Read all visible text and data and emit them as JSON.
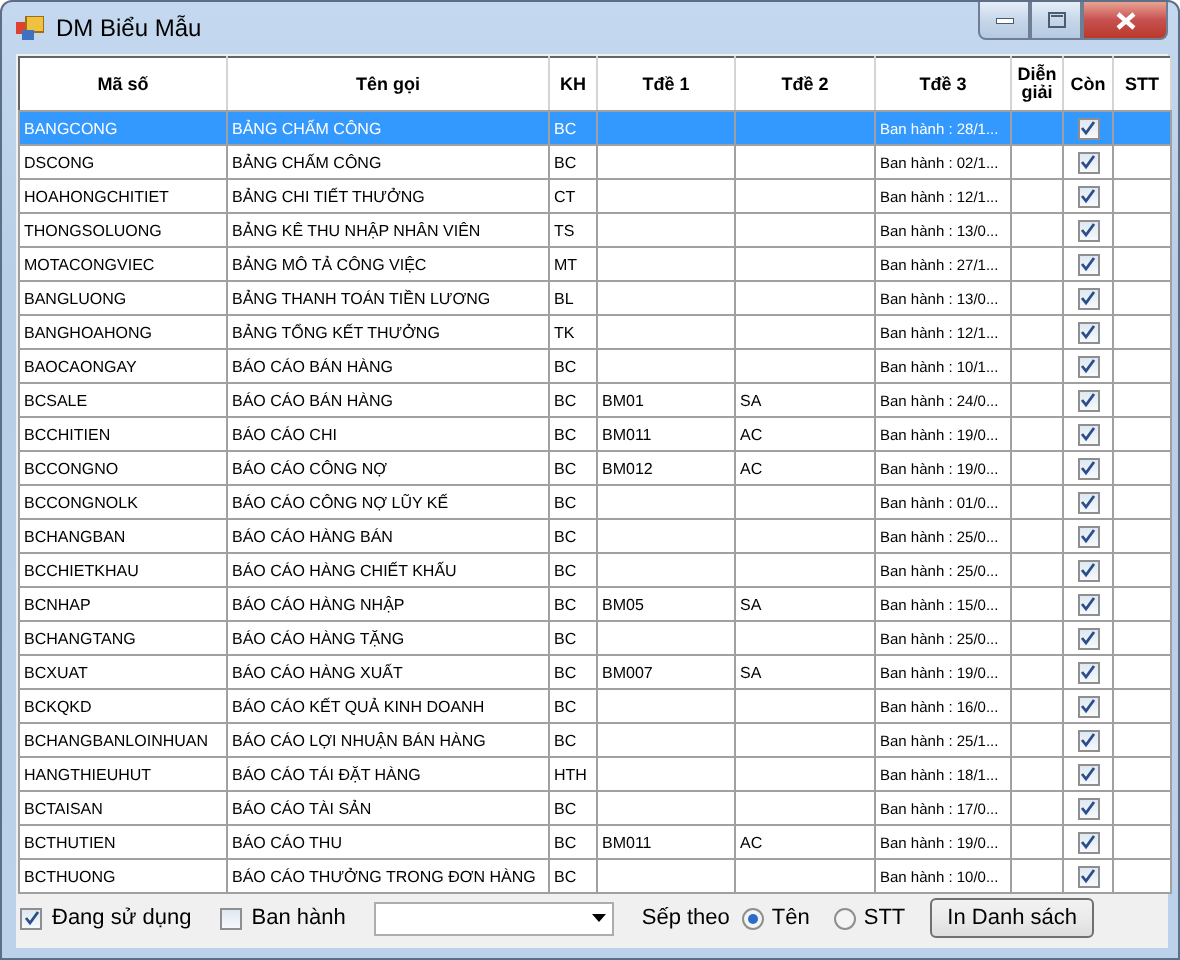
{
  "window": {
    "title": "DM Biểu Mẫu"
  },
  "table": {
    "columns": [
      "Mã số",
      "Tên gọi",
      "KH",
      "Tđề 1",
      "Tđề 2",
      "Tđề 3",
      "Diễn giải",
      "Còn",
      "STT"
    ],
    "rows": [
      {
        "ma_so": "BANGCONG",
        "ten_goi": "BẢNG CHẤM CÔNG",
        "kh": "BC",
        "tde_3": "Ban hành : 28/1...",
        "con": true,
        "selected": true
      },
      {
        "ma_so": "DSCONG",
        "ten_goi": "BẢNG CHẤM CÔNG",
        "kh": "BC",
        "tde_3": "Ban hành : 02/1...",
        "con": true,
        "selected": false
      },
      {
        "ma_so": "HOAHONGCHITIET",
        "ten_goi": "BẢNG CHI TIẾT THƯỞNG",
        "kh": "CT",
        "tde_3": "Ban hành : 12/1...",
        "con": true,
        "selected": false
      },
      {
        "ma_so": "THONGSOLUONG",
        "ten_goi": "BẢNG KÊ THU NHẬP NHÂN VIÊN",
        "kh": "TS",
        "tde_3": "Ban hành : 13/0...",
        "con": true,
        "selected": false
      },
      {
        "ma_so": "MOTACONGVIEC",
        "ten_goi": "BẢNG MÔ TẢ CÔNG VIỆC",
        "kh": "MT",
        "tde_3": "Ban hành : 27/1...",
        "con": true,
        "selected": false
      },
      {
        "ma_so": "BANGLUONG",
        "ten_goi": "BẢNG THANH TOÁN TIỀN LƯƠNG",
        "kh": "BL",
        "tde_3": "Ban hành : 13/0...",
        "con": true,
        "selected": false
      },
      {
        "ma_so": "BANGHOAHONG",
        "ten_goi": "BẢNG TỔNG KẾT THƯỞNG",
        "kh": "TK",
        "tde_3": "Ban hành : 12/1...",
        "con": true,
        "selected": false
      },
      {
        "ma_so": "BAOCAONGAY",
        "ten_goi": "BÁO CÁO BÁN HÀNG",
        "kh": "BC",
        "tde_3": "Ban hành : 10/1...",
        "con": true,
        "selected": false
      },
      {
        "ma_so": "BCSALE",
        "ten_goi": "BÁO CÁO BÁN HÀNG",
        "kh": "BC",
        "tde_1": "BM01",
        "tde_2": "SA",
        "tde_3": "Ban hành : 24/0...",
        "con": true,
        "selected": false
      },
      {
        "ma_so": "BCCHITIEN",
        "ten_goi": "BÁO CÁO CHI",
        "kh": "BC",
        "tde_1": "BM011",
        "tde_2": "AC",
        "tde_3": "Ban hành : 19/0...",
        "con": true,
        "selected": false
      },
      {
        "ma_so": "BCCONGNO",
        "ten_goi": "BÁO CÁO CÔNG NỢ",
        "kh": "BC",
        "tde_1": "BM012",
        "tde_2": "AC",
        "tde_3": "Ban hành : 19/0...",
        "con": true,
        "selected": false
      },
      {
        "ma_so": "BCCONGNOLK",
        "ten_goi": "BÁO CÁO CÔNG NỢ LŨY KẾ",
        "kh": "BC",
        "tde_3": "Ban hành : 01/0...",
        "con": true,
        "selected": false
      },
      {
        "ma_so": "BCHANGBAN",
        "ten_goi": "BÁO CÁO HÀNG BÁN",
        "kh": "BC",
        "tde_3": "Ban hành : 25/0...",
        "con": true,
        "selected": false
      },
      {
        "ma_so": "BCCHIETKHAU",
        "ten_goi": "BÁO CÁO HÀNG CHIẾT KHẤU",
        "kh": "BC",
        "tde_3": "Ban hành : 25/0...",
        "con": true,
        "selected": false
      },
      {
        "ma_so": "BCNHAP",
        "ten_goi": "BÁO CÁO HÀNG NHẬP",
        "kh": "BC",
        "tde_1": "BM05",
        "tde_2": "SA",
        "tde_3": "Ban hành : 15/0...",
        "con": true,
        "selected": false
      },
      {
        "ma_so": "BCHANGTANG",
        "ten_goi": "BÁO CÁO HÀNG TẶNG",
        "kh": "BC",
        "tde_3": "Ban hành : 25/0...",
        "con": true,
        "selected": false
      },
      {
        "ma_so": "BCXUAT",
        "ten_goi": "BÁO CÁO HÀNG XUẤT",
        "kh": "BC",
        "tde_1": "BM007",
        "tde_2": "SA",
        "tde_3": "Ban hành : 19/0...",
        "con": true,
        "selected": false
      },
      {
        "ma_so": "BCKQKD",
        "ten_goi": "BÁO CÁO KẾT QUẢ KINH DOANH",
        "kh": "BC",
        "tde_3": "Ban hành : 16/0...",
        "con": true,
        "selected": false
      },
      {
        "ma_so": "BCHANGBANLOINHUAN",
        "ten_goi": "BÁO CÁO LỢI NHUẬN BÁN HÀNG",
        "kh": "BC",
        "tde_3": "Ban hành : 25/1...",
        "con": true,
        "selected": false
      },
      {
        "ma_so": "HANGTHIEUHUT",
        "ten_goi": "BÁO CÁO TÁI ĐẶT HÀNG",
        "kh": "HTH",
        "tde_3": "Ban hành : 18/1...",
        "con": true,
        "selected": false
      },
      {
        "ma_so": "BCTAISAN",
        "ten_goi": "BÁO CÁO TÀI SẢN",
        "kh": "BC",
        "tde_3": "Ban hành : 17/0...",
        "con": true,
        "selected": false
      },
      {
        "ma_so": "BCTHUTIEN",
        "ten_goi": "BÁO CÁO THU",
        "kh": "BC",
        "tde_1": "BM011",
        "tde_2": "AC",
        "tde_3": "Ban hành : 19/0...",
        "con": true,
        "selected": false
      },
      {
        "ma_so": "BCTHUONG",
        "ten_goi": "BÁO CÁO THƯỞNG TRONG ĐƠN HÀNG",
        "kh": "BC",
        "tde_3": "Ban hành : 10/0...",
        "con": true,
        "selected": false
      }
    ]
  },
  "footer": {
    "in_use": {
      "label": "Đang sử dụng",
      "checked": true
    },
    "issued": {
      "label": "Ban hành",
      "checked": false
    },
    "sort_label": "Sếp theo",
    "sort_options": [
      {
        "label": "Tên",
        "selected": true
      },
      {
        "label": "STT",
        "selected": false
      }
    ],
    "print_button": "In Danh sách"
  }
}
